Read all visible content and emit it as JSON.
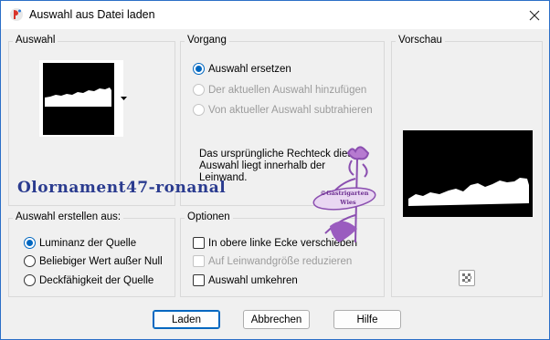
{
  "window": {
    "title": "Auswahl aus Datei laden"
  },
  "selection_group": {
    "label": "Auswahl"
  },
  "process_group": {
    "label": "Vorgang",
    "options": [
      {
        "label": "Auswahl ersetzen",
        "state": "selected"
      },
      {
        "label": "Der aktuellen Auswahl hinzufügen",
        "state": "disabled"
      },
      {
        "label": "Von aktueller Auswahl subtrahieren",
        "state": "disabled"
      }
    ],
    "info_text": "Das ursprüngliche Rechteck dieser Auswahl liegt innerhalb der Leinwand."
  },
  "preview_group": {
    "label": "Vorschau"
  },
  "create_from_group": {
    "label": "Auswahl erstellen aus:",
    "options": [
      {
        "label": "Luminanz der Quelle",
        "state": "selected"
      },
      {
        "label": "Beliebiger Wert außer Null",
        "state": "unselected"
      },
      {
        "label": "Deckfähigkeit der Quelle",
        "state": "unselected"
      }
    ]
  },
  "options_group": {
    "label": "Optionen",
    "options": [
      {
        "label": "In obere linke Ecke verschieben",
        "checked": false,
        "enabled": true
      },
      {
        "label": "Auf Leinwandgröße reduzieren",
        "checked": false,
        "enabled": false
      },
      {
        "label": "Auswahl umkehren",
        "checked": false,
        "enabled": true
      }
    ]
  },
  "buttons": {
    "load": "Laden",
    "cancel": "Abbrechen",
    "help": "Hilfe"
  },
  "watermark": {
    "text": "Olornament47-ronanal",
    "stamp_text": [
      "©Gastrigarten",
      "Wies"
    ]
  },
  "colors": {
    "accent": "#0067c0",
    "watermark": "#8b4fb0",
    "border": "#d9d9d9"
  }
}
